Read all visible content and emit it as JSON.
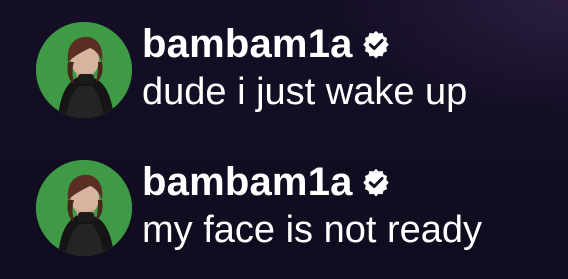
{
  "comments": [
    {
      "username": "bambam1a",
      "verified_icon": "verified-badge-icon",
      "text": "dude i just wake up"
    },
    {
      "username": "bambam1a",
      "verified_icon": "verified-badge-icon",
      "text": "my face is not ready"
    }
  ],
  "colors": {
    "background": "#130e24",
    "avatar_bg": "#3e9a44",
    "text": "#ffffff"
  }
}
